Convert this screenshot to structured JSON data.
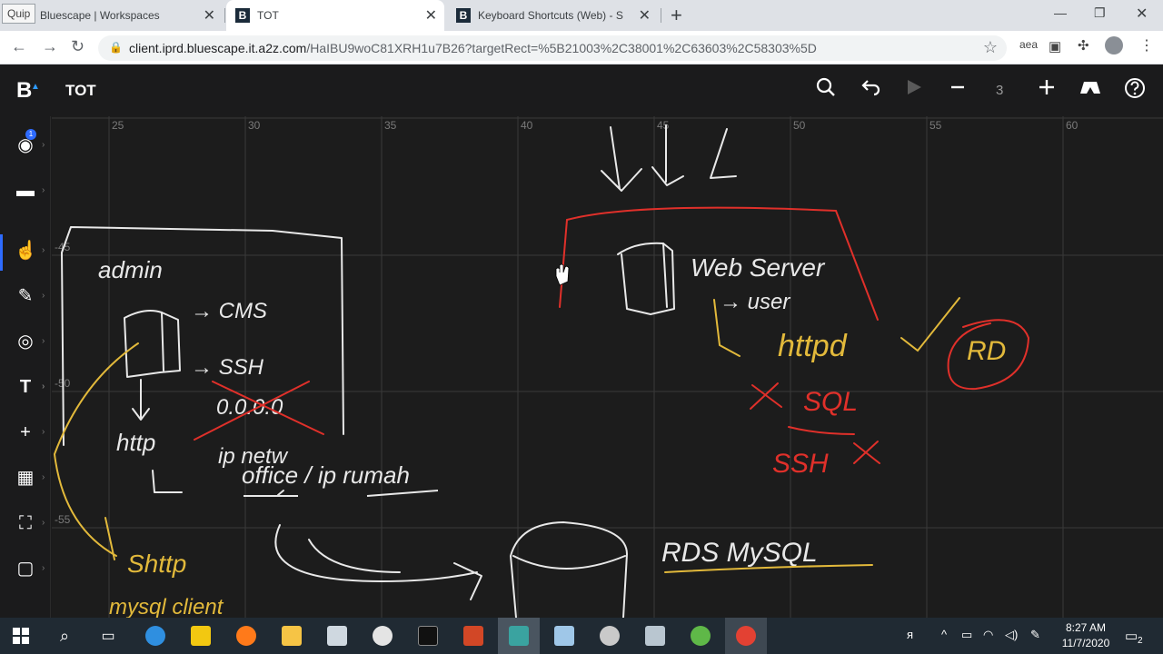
{
  "browser": {
    "tabs": [
      {
        "badge": "Quip",
        "title": "Bluescape | Workspaces"
      },
      {
        "title": "TOT"
      },
      {
        "title": "Keyboard Shortcuts (Web) - Start"
      }
    ],
    "url_host": "client.iprd.bluescape.it.a2z.com",
    "url_path": "/HaIBU9woC81XRH1u7B26?targetRect=%5B21003%2C38001%2C63603%2C58303%5D",
    "ext_label": "aea"
  },
  "app": {
    "logo": "B",
    "workspace_title": "TOT",
    "zoom_value": "3",
    "notification_count": "1"
  },
  "canvas": {
    "ruler_x": [
      "25",
      "30",
      "35",
      "40",
      "45",
      "50",
      "55",
      "60"
    ],
    "ruler_y": [
      "-45",
      "-50",
      "-55"
    ],
    "handwriting": {
      "admin": "admin",
      "cms": "→ CMS",
      "ssh": "→ SSH",
      "ip_crossed": "0.0.0.0",
      "http": "http",
      "ip_net": "ip netw",
      "office": "office / ip rumah",
      "webserver": "Web Server",
      "user": "→ user",
      "httpd": "httpd",
      "rd": "RD",
      "sql": "SQL",
      "ssh_red": "SSH",
      "rds": "RDS MySQL",
      "shttp": "Shttp",
      "mysql_client": "mysql client"
    }
  },
  "taskbar": {
    "time": "8:27 AM",
    "date": "11/7/2020",
    "notifications": "2"
  },
  "colors": {
    "accent": "#2e6bff",
    "ink_white": "#e8e8e8",
    "ink_red": "#e0302a",
    "ink_yellow": "#e2b93b"
  }
}
